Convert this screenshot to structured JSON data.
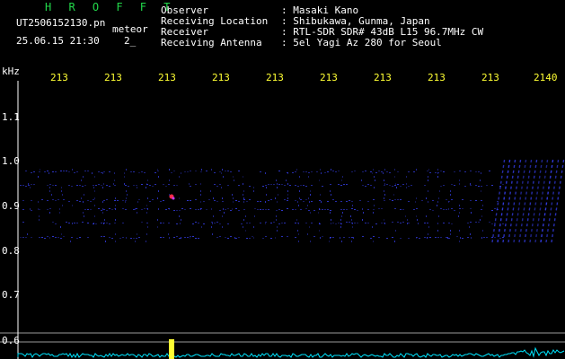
{
  "header": {
    "app_title": "H R O F F T",
    "filename": "UT2506152130.pn",
    "mode": "meteor",
    "datetime": "25.06.15 21:30",
    "extra": "2_",
    "info_labels": [
      "Observer",
      "Receiving Location",
      "Receiver",
      "Receiving Antenna"
    ],
    "info_values": [
      ": Masaki Kano",
      ": Shibukawa, Gunma, Japan",
      ": RTL-SDR SDR# 43dB L15 96.7MHz CW",
      ": 5el Yagi Az 280 for Seoul"
    ]
  },
  "axis": {
    "y_unit": "kHz",
    "y_ticks": [
      "1.1",
      "1.0",
      "0.9",
      "0.8",
      "0.7",
      "0.6"
    ],
    "x_ticks": [
      "213",
      "213",
      "213",
      "213",
      "213",
      "213",
      "213",
      "213",
      "213",
      "2140"
    ]
  },
  "colors": {
    "background": "#000000",
    "header_green": "#22d84a",
    "tick_yellow": "#ffff33",
    "signal_blue": "#3a44ff",
    "baseline_cyan": "#00e5ff",
    "meteor_red": "#ff2a4a"
  }
}
